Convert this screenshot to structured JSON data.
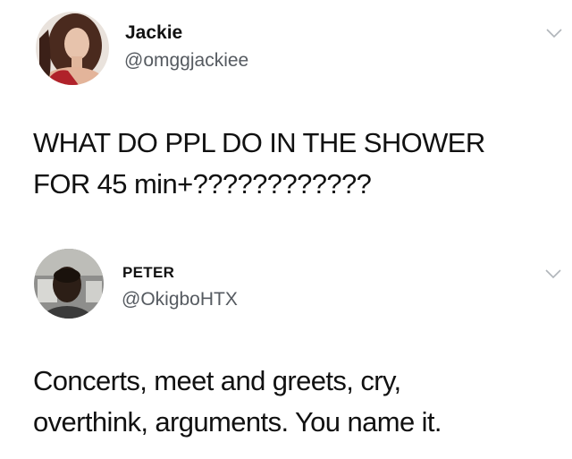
{
  "tweets": [
    {
      "display_name": "Jackie",
      "handle": "@omggjackiee",
      "lines": [
        "WHAT DO PPL DO IN THE SHOWER",
        "FOR 45 min+????????????"
      ],
      "avatar_icon": "profile-photo"
    },
    {
      "display_name": "PETER",
      "handle": "@OkigboHTX",
      "lines": [
        "Concerts, meet and greets, cry,",
        "overthink, arguments. You name it."
      ],
      "avatar_icon": "profile-photo"
    }
  ],
  "menu_icon": "chevron-down-icon",
  "colors": {
    "background": "#ffffff",
    "text": "#111111",
    "handle": "#555a60",
    "chevron": "#b0b5ba"
  }
}
